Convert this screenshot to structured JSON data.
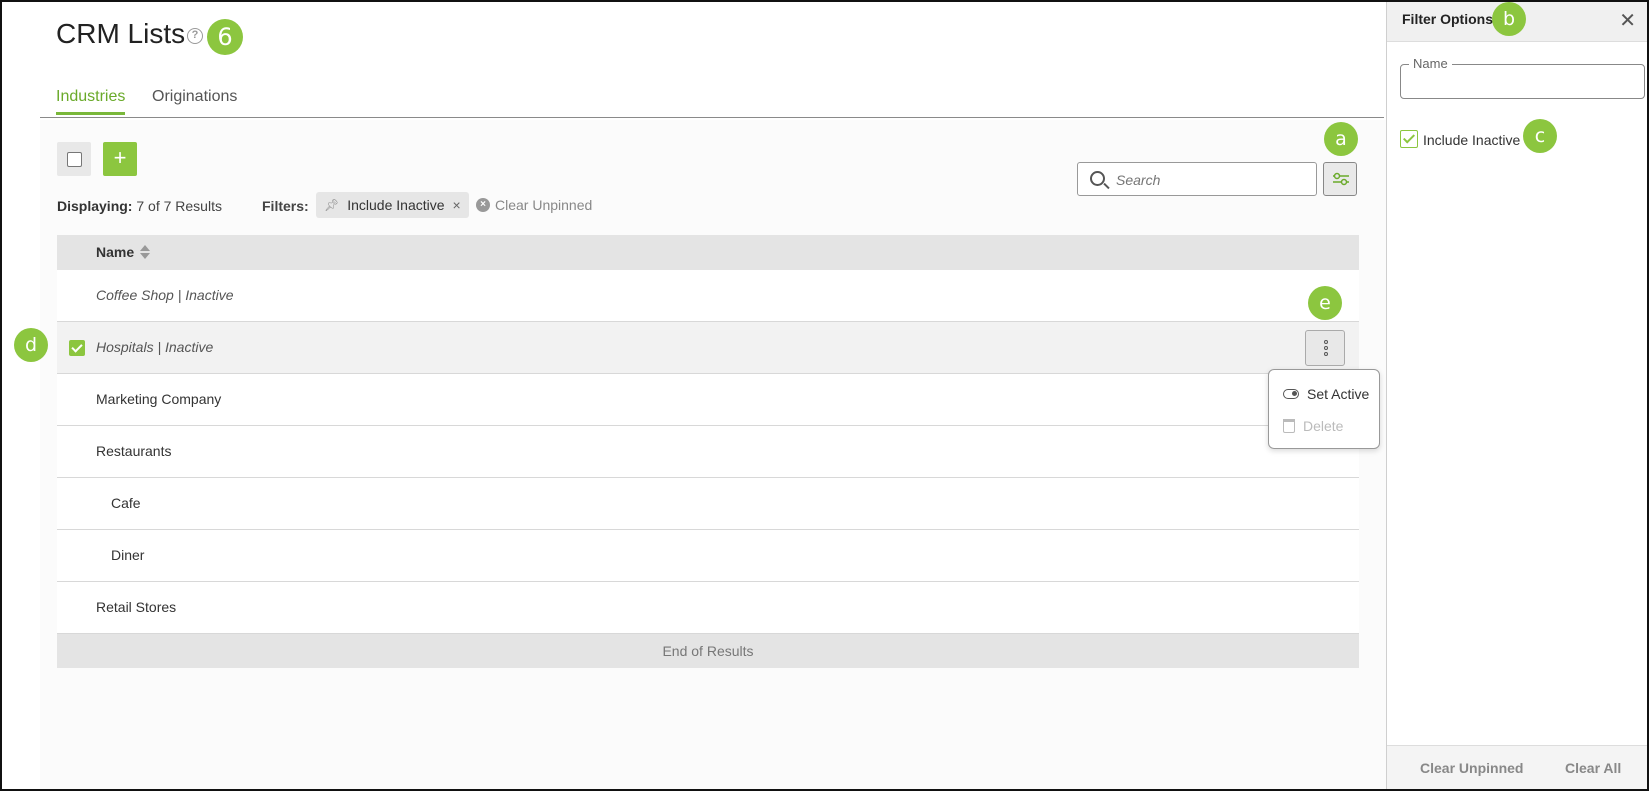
{
  "page": {
    "title": "CRM Lists",
    "help_icon": "?",
    "step_badge": "6"
  },
  "tabs": [
    {
      "label": "Industries",
      "active": true
    },
    {
      "label": "Originations",
      "active": false
    }
  ],
  "toolbar": {
    "add_icon": "+",
    "search_placeholder": "Search",
    "filter_icon": "filter-settings-icon"
  },
  "status": {
    "displaying_label": "Displaying:",
    "displaying_value": "7 of 7 Results",
    "filters_label": "Filters:",
    "chip_label": "Include Inactive",
    "chip_remove": "×",
    "clear_unpinned": "Clear Unpinned"
  },
  "table": {
    "column_name": "Name",
    "rows": [
      {
        "name": "Coffee Shop | Inactive",
        "inactive": true,
        "selected": false,
        "indent": false
      },
      {
        "name": "Hospitals | Inactive",
        "inactive": true,
        "selected": true,
        "indent": false
      },
      {
        "name": "Marketing Company",
        "inactive": false,
        "selected": false,
        "indent": false
      },
      {
        "name": "Restaurants",
        "inactive": false,
        "selected": false,
        "indent": false
      },
      {
        "name": "Cafe",
        "inactive": false,
        "selected": false,
        "indent": true
      },
      {
        "name": "Diner",
        "inactive": false,
        "selected": false,
        "indent": true
      },
      {
        "name": "Retail Stores",
        "inactive": false,
        "selected": false,
        "indent": false
      }
    ],
    "end_label": "End of Results"
  },
  "row_menu": {
    "items": [
      {
        "label": "Set Active",
        "icon": "toggle-icon",
        "disabled": false
      },
      {
        "label": "Delete",
        "icon": "trash-icon",
        "disabled": true
      }
    ]
  },
  "filter_panel": {
    "title": "Filter Options",
    "close_icon": "✕",
    "name_label": "Name",
    "name_value": "",
    "include_inactive_label": "Include Inactive",
    "include_inactive_checked": true,
    "clear_unpinned": "Clear Unpinned",
    "clear_all": "Clear All"
  },
  "annotations": {
    "a": "a",
    "b": "b",
    "c": "c",
    "d": "d",
    "e": "e"
  },
  "colors": {
    "accent": "#8cc63f",
    "tab_active": "#6aaa2a",
    "header_bg": "#e4e4e4"
  }
}
